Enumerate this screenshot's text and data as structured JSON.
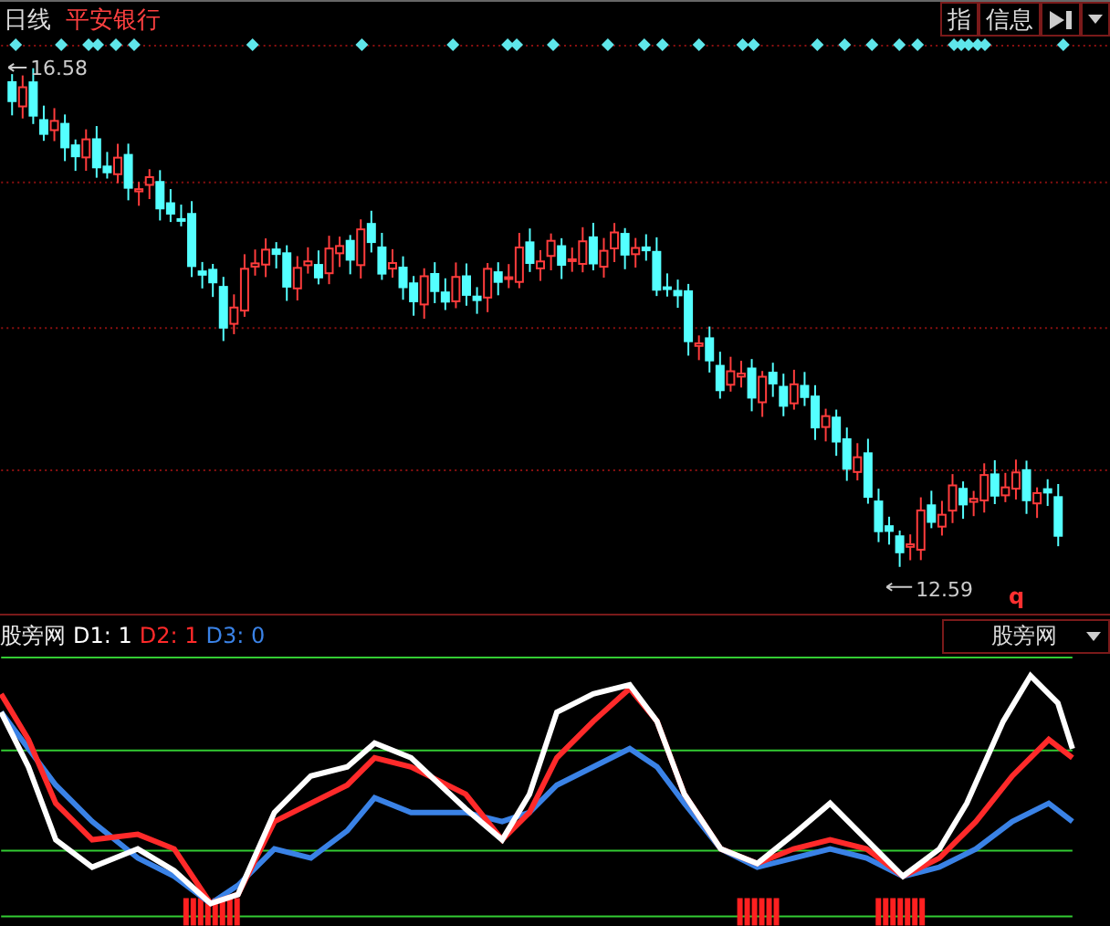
{
  "top_bar": {
    "period": "日线",
    "stock_name": "平安银行",
    "buttons": [
      {
        "label": "指"
      },
      {
        "label": "信息"
      }
    ]
  },
  "price_chart": {
    "high_label": "16.58",
    "low_label": "12.59",
    "marker": "q"
  },
  "indicator": {
    "name": "股旁网",
    "values": [
      {
        "label": "D1: 1",
        "color": "#ffffff"
      },
      {
        "label": "D2: 1",
        "color": "#ff2a2a"
      },
      {
        "label": "D3: 0",
        "color": "#3a82e6"
      }
    ],
    "selector": "股旁网"
  }
}
